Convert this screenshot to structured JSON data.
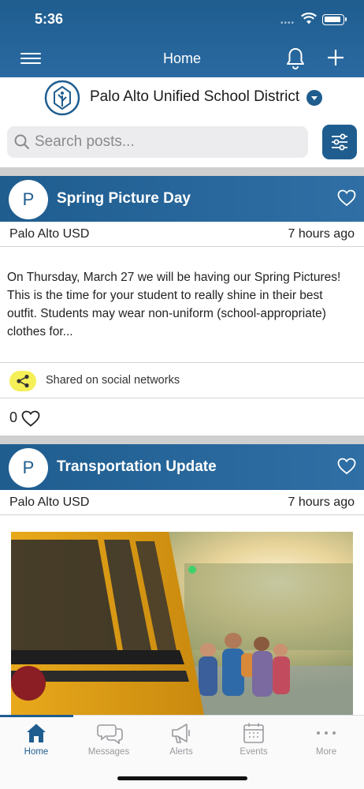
{
  "status_bar": {
    "time": "5:36"
  },
  "header": {
    "title": "Home"
  },
  "district": {
    "name": "Palo Alto Unified School District"
  },
  "search": {
    "placeholder": "Search posts...",
    "value": ""
  },
  "posts": [
    {
      "avatar_letter": "P",
      "title": "Spring Picture Day",
      "author": "Palo Alto USD",
      "time_ago": "7 hours ago",
      "body": "On Thursday, March 27 we will be having our Spring Pictures! This is the time for your student to really shine in their best outfit. Students may wear non-uniform (school-appropriate) clothes for...",
      "share_label": "Shared on social networks",
      "likes": "0"
    },
    {
      "avatar_letter": "P",
      "title": "Transportation Update",
      "author": "Palo Alto USD",
      "time_ago": "7 hours ago",
      "image_icon": "school-bus-photo"
    }
  ],
  "tabs": [
    {
      "label": "Home",
      "icon": "home-icon",
      "active": true
    },
    {
      "label": "Messages",
      "icon": "messages-icon",
      "active": false
    },
    {
      "label": "Alerts",
      "icon": "megaphone-icon",
      "active": false
    },
    {
      "label": "Events",
      "icon": "calendar-icon",
      "active": false
    },
    {
      "label": "More",
      "icon": "more-icon",
      "active": false
    }
  ],
  "colors": {
    "primary": "#1f5d8f",
    "share_badge": "#f5ef58",
    "tab_inactive": "#9a9aa0"
  }
}
